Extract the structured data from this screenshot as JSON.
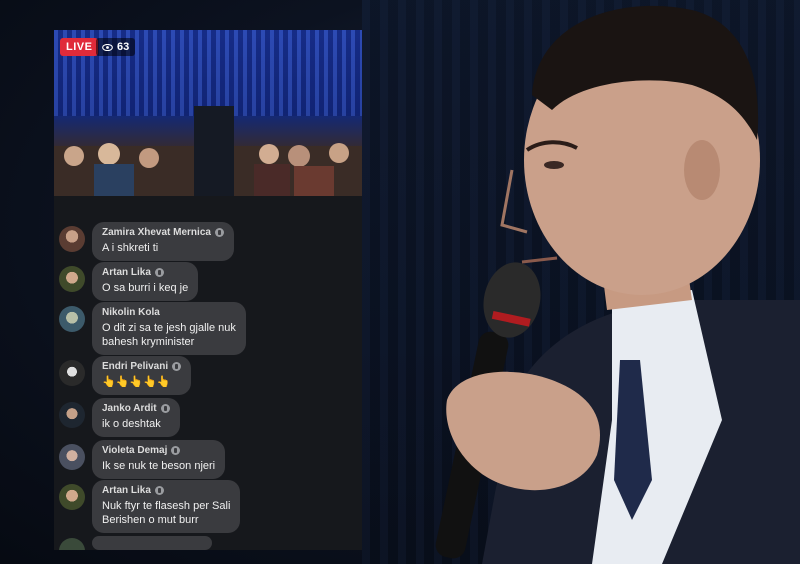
{
  "stream": {
    "live_label": "LIVE",
    "viewer_count": "63",
    "viewer_icon": "eye-icon"
  },
  "comments": [
    {
      "name": "Zamira Xhevat Mernica",
      "message": "A i shkreti ti"
    },
    {
      "name": "Artan Lika",
      "message": "O sa burri i keq je"
    },
    {
      "name": "Nikolin Kola",
      "message": "O dit zi sa te jesh gjalle nuk",
      "message_line2": "bahesh kryminister"
    },
    {
      "name": "Endri Pelivani",
      "message": "👆👆👆👆👆"
    },
    {
      "name": "Janko Ardit",
      "message": "ik o deshtak"
    },
    {
      "name": "Violeta Demaj",
      "message": "Ik se nuk te beson njeri"
    },
    {
      "name": "Artan Lika",
      "message": "Nuk ftyr te flasesh per Sali",
      "message_line2": "Berishen o mut burr"
    }
  ],
  "colors": {
    "live": "#e02b3a",
    "bubble": "#3a3b3f",
    "phone_bg": "#16181c"
  }
}
